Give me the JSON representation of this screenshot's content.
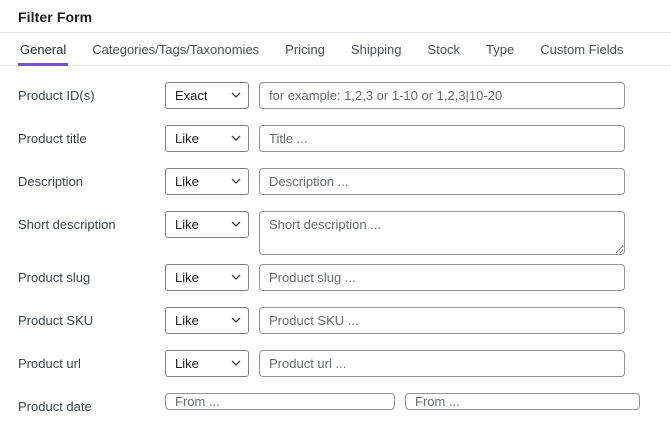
{
  "theme": {
    "accent_color": "#7156c8"
  },
  "header": {
    "title": "Filter Form"
  },
  "tabs": [
    {
      "label": "General",
      "active": true
    },
    {
      "label": "Categories/Tags/Taxonomies",
      "active": false
    },
    {
      "label": "Pricing",
      "active": false
    },
    {
      "label": "Shipping",
      "active": false
    },
    {
      "label": "Stock",
      "active": false
    },
    {
      "label": "Type",
      "active": false
    },
    {
      "label": "Custom Fields",
      "active": false
    }
  ],
  "rows": [
    {
      "label": "Product ID(s)",
      "operator": "Exact",
      "placeholder": "for example: 1,2,3 or 1-10 or 1,2,3|10-20",
      "value": ""
    },
    {
      "label": "Product title",
      "operator": "Like",
      "placeholder": "Title ...",
      "value": ""
    },
    {
      "label": "Description",
      "operator": "Like",
      "placeholder": "Description ...",
      "value": ""
    },
    {
      "label": "Short description",
      "operator": "Like",
      "placeholder": "Short description ...",
      "value": ""
    },
    {
      "label": "Product slug",
      "operator": "Like",
      "placeholder": "Product slug ...",
      "value": ""
    },
    {
      "label": "Product SKU",
      "operator": "Like",
      "placeholder": "Product SKU ...",
      "value": ""
    },
    {
      "label": "Product url",
      "operator": "Like",
      "placeholder": "Product url ...",
      "value": ""
    },
    {
      "label": "Product date",
      "placeholders": {
        "from": "From ...",
        "to": "From ..."
      },
      "value_from": "",
      "value_to": ""
    }
  ],
  "icons": {
    "select_chevron": "chevron-down-icon",
    "textarea_grip": "resize-grip-icon"
  }
}
